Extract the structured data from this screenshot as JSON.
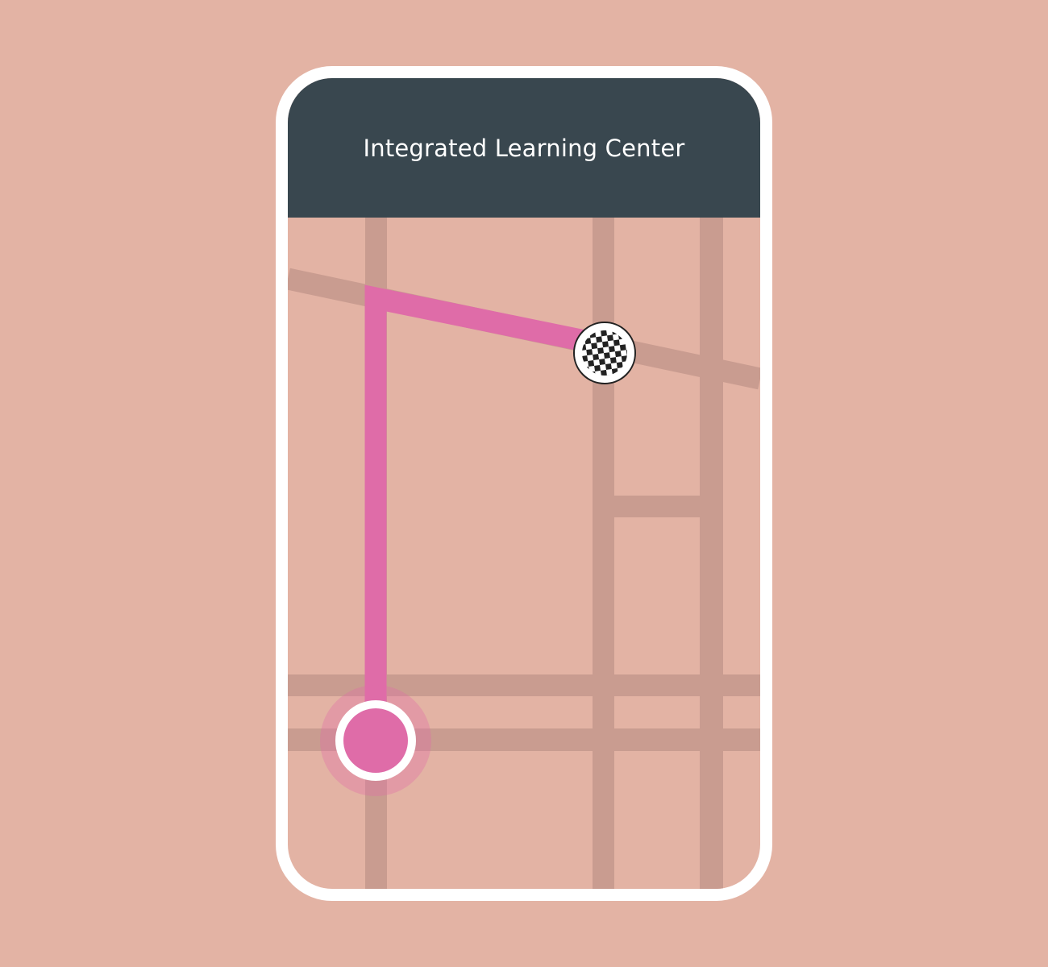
{
  "app": {
    "header_title": "Integrated Learning Center"
  },
  "colors": {
    "background": "#E3B3A4",
    "header": "#39474F",
    "road": "#C99C90",
    "route": "#DF6CA8",
    "frame": "#FFFFFF"
  },
  "icons": {
    "origin": "current-location-icon",
    "destination": "checkered-flag-icon"
  }
}
